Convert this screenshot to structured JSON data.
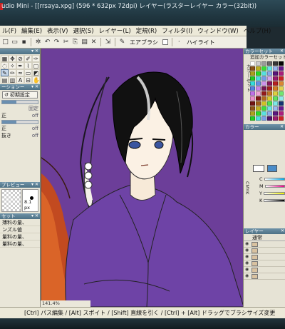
{
  "window": {
    "title": "udio Mini - [[rrsaya.xpg] (596 * 632px 72dpi)   レイヤー(ラスターレイヤー カラー(32bit))"
  },
  "menu": {
    "items": [
      "ル(F)",
      "編集(E)",
      "表示(V)",
      "選択(S)",
      "レイヤー(L)",
      "定規(R)",
      "フィルタ(I)",
      "ウィンドウ(W)",
      "ヘルプ(H)"
    ]
  },
  "toolbar": {
    "brush_label": "エアブラシ",
    "highlight_label": "ハイライト"
  },
  "left_panel": {
    "tools_header": "",
    "options_header": "ーションー",
    "preset_button": "初期設定",
    "fixed_label": "固定",
    "opt_rows": [
      {
        "label": "正",
        "value": "off"
      },
      {
        "label": "正",
        "value": "off"
      },
      {
        "label": "抜き",
        "value": "off"
      }
    ],
    "preview_header": "プレビュー",
    "brush_size": "8.1 px",
    "set_header": "セット",
    "list_items": [
      "薄料の量、",
      "ンズル値",
      "量料の量、",
      "量料の量、"
    ]
  },
  "zoom": {
    "value": "141.4%"
  },
  "right_panel": {
    "colorset_header": "カラーセット",
    "colorset_name": "追加カラーセット",
    "colorset_vlabel": "カラーセット",
    "color_header": "カラー",
    "cmyk_vlabel": "CMYK",
    "cmyk": [
      {
        "label": "C"
      },
      {
        "label": "M"
      },
      {
        "label": "Y"
      },
      {
        "label": "K"
      }
    ],
    "layer_header": "レイヤー",
    "blend_mode": "通常"
  },
  "status": {
    "hint": "[Ctrl] パス編集 / [Alt] スポイト / [Shift] 直線を引く / [Ctrl] + [Alt] ドラッグでブラシサイズ変更"
  },
  "colors": {
    "canvas_bg": "#6c3e99",
    "title_bg": "#203640",
    "panel_head": "#5b7f93"
  }
}
